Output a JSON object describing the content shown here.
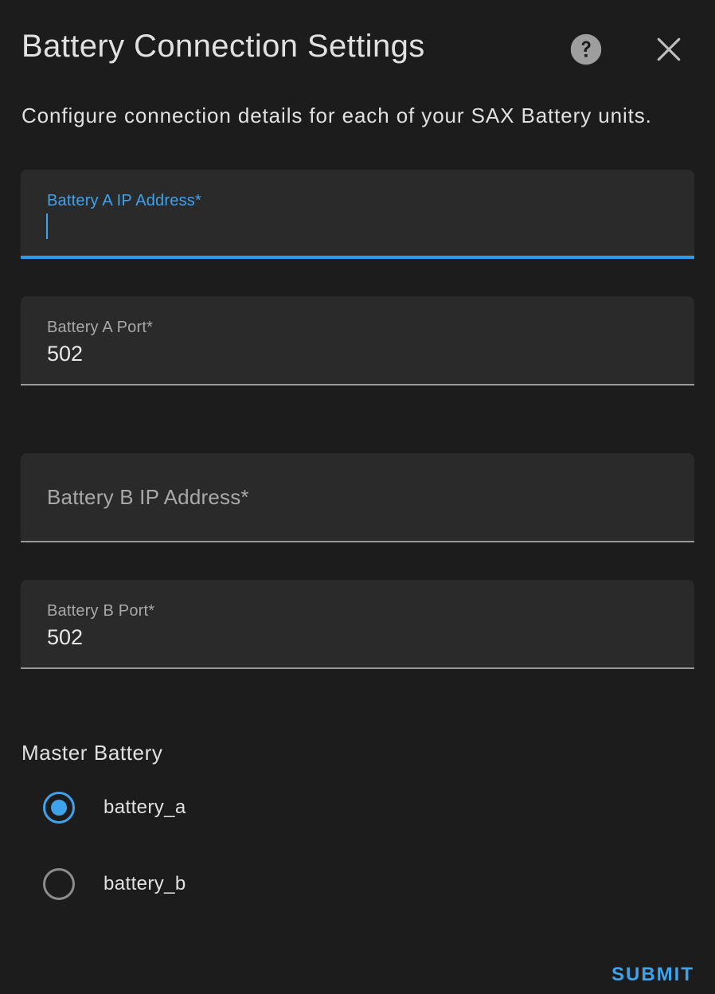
{
  "dialog": {
    "title": "Battery Connection Settings",
    "help_icon": "help-circle-icon",
    "close_icon": "close-icon",
    "description": "Configure connection details for each of your SAX Battery units.",
    "accent_color": "#3fa3ec"
  },
  "fields": {
    "battery_a_ip": {
      "label": "Battery A IP Address*",
      "value": "",
      "focused": true
    },
    "battery_a_port": {
      "label": "Battery A Port*",
      "value": "502"
    },
    "battery_b_ip": {
      "label": "Battery B IP Address*",
      "value": ""
    },
    "battery_b_port": {
      "label": "Battery B Port*",
      "value": "502"
    }
  },
  "master_battery": {
    "label": "Master Battery",
    "options": [
      {
        "label": "battery_a",
        "selected": true
      },
      {
        "label": "battery_b",
        "selected": false
      }
    ]
  },
  "actions": {
    "submit_label": "SUBMIT"
  }
}
